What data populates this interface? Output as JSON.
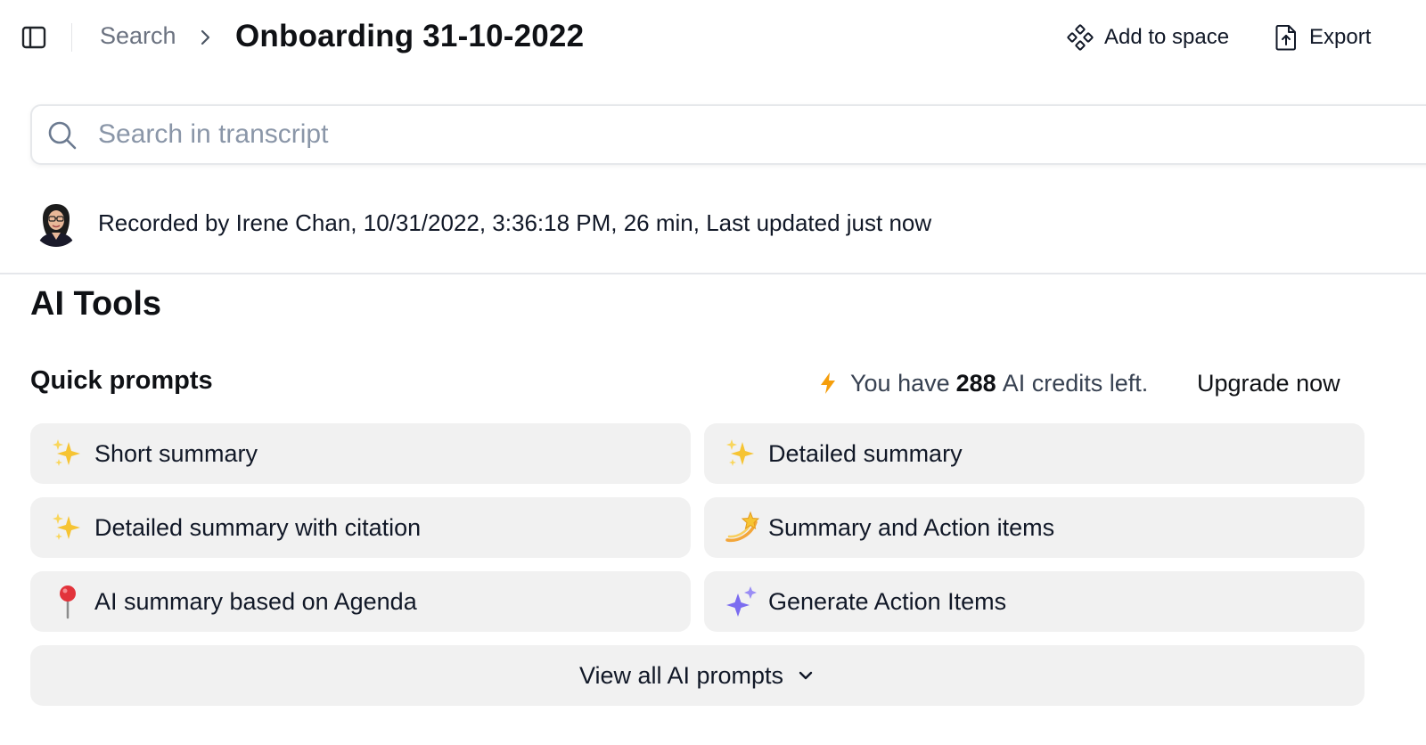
{
  "header": {
    "breadcrumb_root": "Search",
    "title": "Onboarding 31-10-2022",
    "add_to_space_label": "Add to space",
    "export_label": "Export"
  },
  "search": {
    "placeholder": "Search in transcript",
    "value": ""
  },
  "meta": {
    "text": "Recorded by Irene Chan, 10/31/2022, 3:36:18 PM, 26 min, Last updated just now"
  },
  "ai_tools": {
    "title": "AI Tools",
    "quick_prompts_title": "Quick prompts",
    "credits_prefix": "You have",
    "credits_count": "288",
    "credits_suffix": "AI credits left.",
    "upgrade_label": "Upgrade now",
    "prompts": [
      {
        "label": "Short summary",
        "icon": "sparkles-icon"
      },
      {
        "label": "Detailed summary",
        "icon": "sparkles-icon"
      },
      {
        "label": "Detailed summary with citation",
        "icon": "sparkles-icon"
      },
      {
        "label": "Summary and Action items",
        "icon": "dizzy-star-icon"
      },
      {
        "label": "AI summary based on Agenda",
        "icon": "pushpin-icon"
      },
      {
        "label": "Generate Action Items",
        "icon": "purple-sparkle-icon"
      }
    ],
    "view_all_label": "View all AI prompts"
  },
  "colors": {
    "accent_bolt": "#f59e0b",
    "prompt_bg": "#f1f1f1",
    "placeholder": "#8a96a8"
  }
}
